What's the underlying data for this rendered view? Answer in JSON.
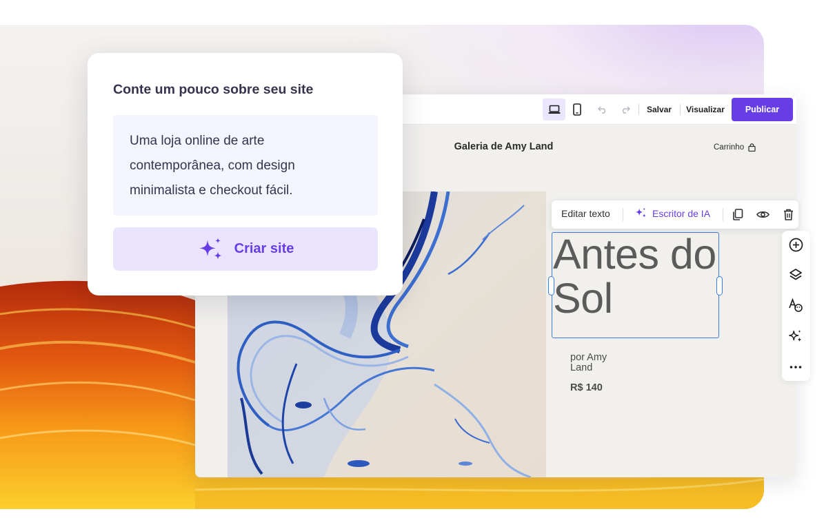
{
  "prompt_card": {
    "heading": "Conte um pouco sobre seu site",
    "prompt_text": "Uma loja online de arte contemporânea, com design minimalista e checkout fácil.",
    "create_button": {
      "label": "Criar site",
      "icon": "sparkles-icon"
    }
  },
  "editor": {
    "toolbar": {
      "device_desktop_icon": "laptop-icon",
      "device_mobile_icon": "mobile-icon",
      "undo_icon": "undo-icon",
      "redo_icon": "redo-icon",
      "save_label": "Salvar",
      "preview_label": "Visualizar",
      "publish_label": "Publicar"
    },
    "site": {
      "title": "Galeria de Amy Land",
      "cart_label": "Carrinho",
      "product_title": "Antes do Sol",
      "byline": "por Amy Land",
      "price": "R$ 140"
    },
    "text_toolbar": {
      "edit_label": "Editar texto",
      "ai_label": "Escritor de IA",
      "icons": [
        "duplicate-icon",
        "eye-icon",
        "trash-icon"
      ]
    },
    "side_rail": {
      "icons": [
        "add-icon",
        "layers-icon",
        "text-style-icon",
        "ai-sparkles-icon",
        "more-icon"
      ]
    }
  },
  "colors": {
    "accent": "#673de6",
    "accent_light": "#ebe4ff",
    "selection": "#3b7ce4",
    "text_dark": "#36344d"
  }
}
